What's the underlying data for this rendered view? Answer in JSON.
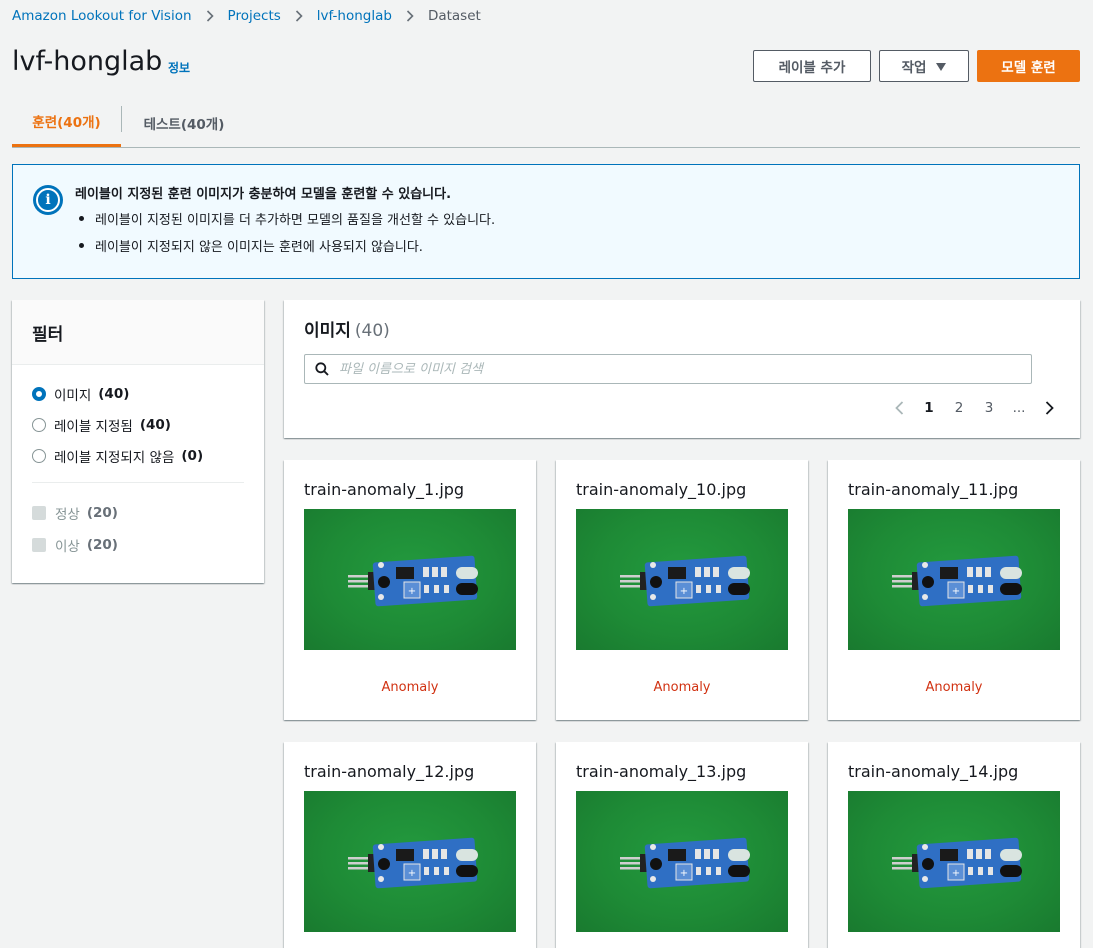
{
  "breadcrumb": {
    "items": [
      "Amazon Lookout for Vision",
      "Projects",
      "lvf-honglab"
    ],
    "current": "Dataset"
  },
  "header": {
    "title": "lvf-honglab",
    "info": "정보",
    "add_label_button": "레이블 추가",
    "actions_button": "작업",
    "train_model_button": "모델 훈련"
  },
  "tabs": [
    {
      "label": "훈련(40개)",
      "active": true
    },
    {
      "label": "테스트(40개)",
      "active": false
    }
  ],
  "alert": {
    "title": "레이블이 지정된 훈련 이미지가 충분하여 모델을 훈련할 수 있습니다.",
    "items": [
      "레이블이 지정된 이미지를 더 추가하면 모델의 품질을 개선할 수 있습니다.",
      "레이블이 지정되지 않은 이미지는 훈련에 사용되지 않습니다."
    ]
  },
  "filter": {
    "title": "필터",
    "radios": [
      {
        "label": "이미지",
        "count": "(40)",
        "checked": true
      },
      {
        "label": "레이블 지정됨",
        "count": "(40)",
        "checked": false
      },
      {
        "label": "레이블 지정되지 않음",
        "count": "(0)",
        "checked": false
      }
    ],
    "checkboxes": [
      {
        "label": "정상",
        "count": "(20)"
      },
      {
        "label": "이상",
        "count": "(20)"
      }
    ]
  },
  "images": {
    "title": "이미지",
    "count": "(40)",
    "search_placeholder": "파일 이름으로 이미지 검색",
    "pagination": {
      "pages": [
        "1",
        "2",
        "3"
      ],
      "ellipsis": "...",
      "current": "1"
    }
  },
  "cards": [
    {
      "filename": "train-anomaly_1.jpg",
      "label": "Anomaly"
    },
    {
      "filename": "train-anomaly_10.jpg",
      "label": "Anomaly"
    },
    {
      "filename": "train-anomaly_11.jpg",
      "label": "Anomaly"
    },
    {
      "filename": "train-anomaly_12.jpg",
      "label": ""
    },
    {
      "filename": "train-anomaly_13.jpg",
      "label": ""
    },
    {
      "filename": "train-anomaly_14.jpg",
      "label": ""
    }
  ],
  "colors": {
    "link": "#0073bb",
    "primary": "#ec7211",
    "anomaly": "#d13212",
    "alert_bg": "#f1faff"
  }
}
